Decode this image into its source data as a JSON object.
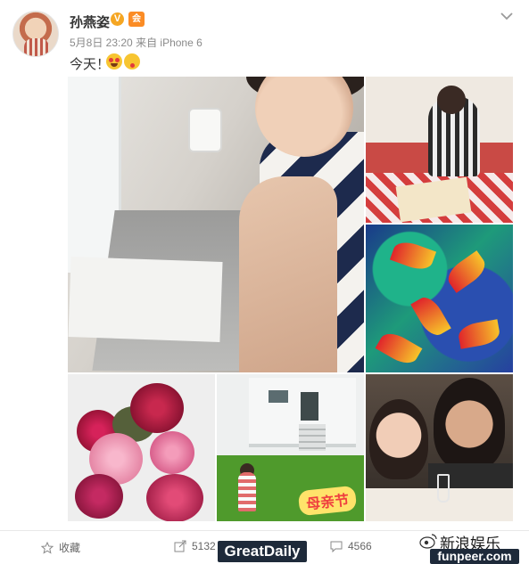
{
  "post": {
    "username": "孙燕姿",
    "verified_badge": "V",
    "member_badge": "会",
    "timestamp": "5月8日 23:20",
    "source": "来自 iPhone 6",
    "text": "今天！",
    "emojis": [
      "heart-eyes-emoji",
      "kiss-emoji"
    ]
  },
  "photos": {
    "stamp_text": "母亲节"
  },
  "footer": {
    "favorite_label": "收藏",
    "share_count": "5132",
    "comment_count": "4566"
  },
  "watermarks": {
    "greatdaily": "GreatDaily",
    "sina": "新浪娱乐",
    "funpeer": "funpeer.com"
  },
  "colors": {
    "verified": "#f5a623",
    "member": "#fb8c25",
    "watermark_bg": "#1e2a3a"
  },
  "icons": {
    "more": "chevron-down-icon",
    "favorite": "star-icon",
    "share": "share-icon",
    "comment": "comment-icon",
    "weibo": "weibo-icon"
  }
}
